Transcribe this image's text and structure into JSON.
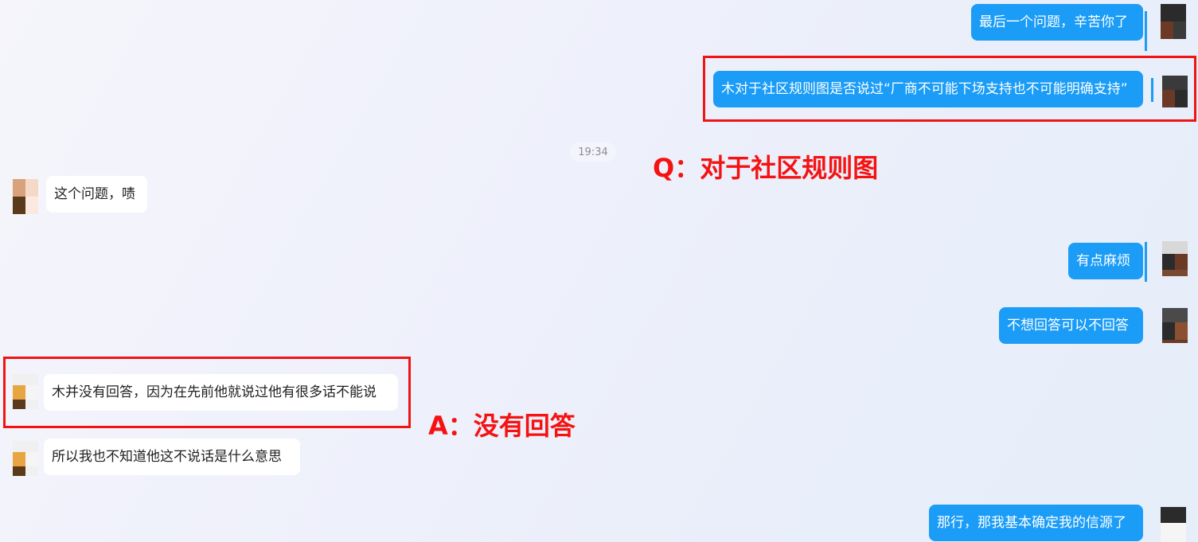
{
  "timestamp": "19:34",
  "messages": [
    {
      "id": "m1",
      "side": "out",
      "text": "最后一个问题，辛苦你了"
    },
    {
      "id": "m2",
      "side": "out",
      "text": "木对于社区规则图是否说过“厂商不可能下场支持也不可能明确支持”"
    },
    {
      "id": "m3",
      "side": "in",
      "text": "这个问题，啧"
    },
    {
      "id": "m4",
      "side": "out",
      "text": "有点麻烦"
    },
    {
      "id": "m5",
      "side": "out",
      "text": "不想回答可以不回答"
    },
    {
      "id": "m6",
      "side": "in",
      "text": "木并没有回答，因为在先前他就说过他有很多话不能说"
    },
    {
      "id": "m7",
      "side": "in",
      "text": "所以我也不知道他这不说话是什么意思"
    },
    {
      "id": "m8",
      "side": "out",
      "text": "那行，那我基本确定我的信源了"
    }
  ],
  "annotations": {
    "question": "Q：对于社区规则图",
    "answer": "A：没有回答"
  },
  "colors": {
    "outgoing_bubble": "#1a9cf7",
    "incoming_bubble": "#ffffff",
    "highlight": "#f01414"
  }
}
